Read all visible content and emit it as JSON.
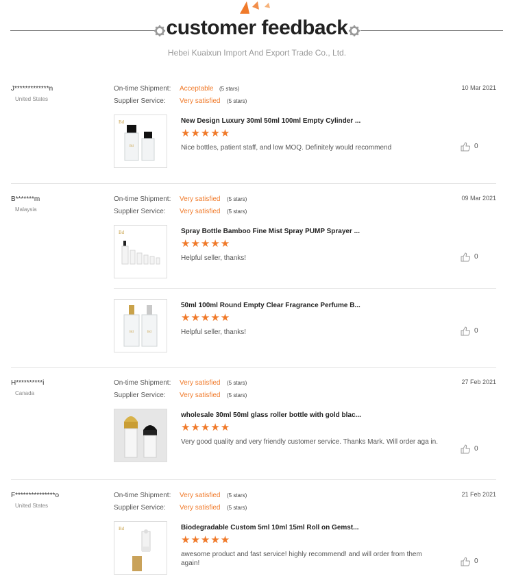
{
  "header": {
    "title": "customer feedback",
    "subtitle": "Hebei Kuaixun Import And Export Trade Co., Ltd."
  },
  "labels": {
    "shipment": "On-time Shipment:",
    "service": "Supplier Service:"
  },
  "colors": {
    "accent": "#f07a2a",
    "gear": "#999999"
  },
  "reviews": [
    {
      "name": "J*************n",
      "country": "United States",
      "date": "10 Mar 2021",
      "shipment": "Acceptable",
      "shipment_stars": "(5 stars)",
      "service": "Very satisfied",
      "service_stars": "(5 stars)",
      "products": [
        {
          "title": "New Design Luxury 30ml 50ml 100ml Empty Cylinder ...",
          "rating": 5,
          "stars": "★★★★★",
          "comment": "Nice bottles, patient staff, and low MOQ. Definitely would recommend",
          "likes": "0",
          "image": "two-bottles-black-caps"
        }
      ]
    },
    {
      "name": "B*******m",
      "country": "Malaysia",
      "date": "09 Mar 2021",
      "shipment": "Very satisfied",
      "shipment_stars": "(5 stars)",
      "service": "Very satisfied",
      "service_stars": "(5 stars)",
      "products": [
        {
          "title": "Spray Bottle Bamboo Fine Mist Spray PUMP Sprayer ...",
          "rating": 5,
          "stars": "★★★★★",
          "comment": "Helpful seller, thanks!",
          "likes": "0",
          "image": "spray-bottle-set"
        },
        {
          "title": "50ml 100ml Round Empty Clear Fragrance Perfume B...",
          "rating": 5,
          "stars": "★★★★★",
          "comment": "Helpful seller, thanks!",
          "likes": "0",
          "image": "two-perfume-bottles"
        }
      ]
    },
    {
      "name": "H**********i",
      "country": "Canada",
      "date": "27 Feb 2021",
      "shipment": "Very satisfied",
      "shipment_stars": "(5 stars)",
      "service": "Very satisfied",
      "service_stars": "(5 stars)",
      "products": [
        {
          "title": "wholesale 30ml 50ml glass roller bottle with gold blac...",
          "rating": 5,
          "stars": "★★★★★",
          "comment": "Very good quality and very friendly customer service. Thanks Mark. Will order aga in.",
          "likes": "0",
          "image": "roller-bottles"
        }
      ]
    },
    {
      "name": "F***************o",
      "country": "United States",
      "date": "21 Feb 2021",
      "shipment": "Very satisfied",
      "shipment_stars": "(5 stars)",
      "service": "Very satisfied",
      "service_stars": "(5 stars)",
      "products": [
        {
          "title": "Biodegradable Custom 5ml 10ml 15ml Roll on Gemst...",
          "rating": 5,
          "stars": "★★★★★",
          "comment": "awesome product and fast service! highly recommend! and will order from them again!",
          "likes": "0",
          "image": "roll-on-bottle"
        }
      ]
    }
  ]
}
